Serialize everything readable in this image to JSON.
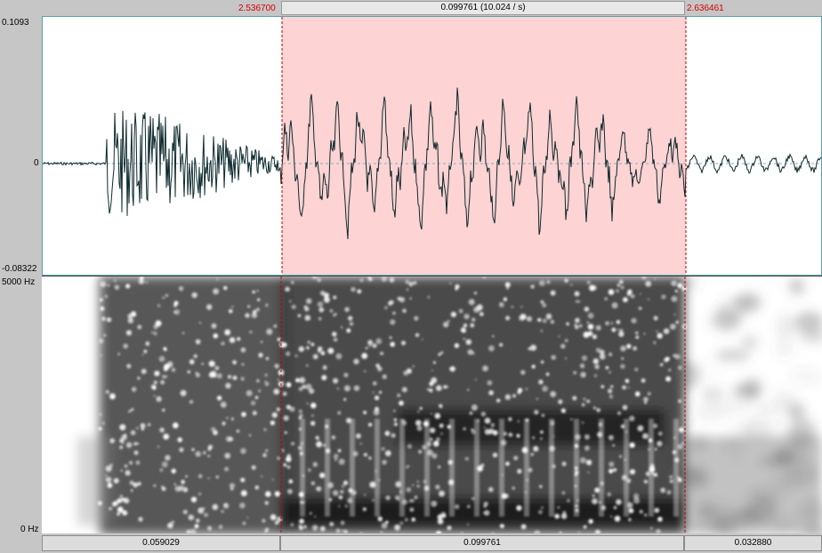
{
  "selection": {
    "start": "2.536700",
    "end": "2.636461",
    "duration_label": "0.099761 (10.024 / s)"
  },
  "waveform": {
    "y_max": "0.1093",
    "y_zero": "0",
    "y_min": "-0.08322"
  },
  "spectrogram": {
    "f_max": "5000 Hz",
    "f_min": "0 Hz"
  },
  "bottom_bar": {
    "left": "0.059029",
    "middle": "0.099761",
    "right": "0.032880"
  },
  "colors": {
    "selection_fill": "#fdd3d3",
    "cursor_line": "#c00000",
    "waveform_line": "#0e2a2e",
    "panel_border": "#5a9fae"
  }
}
